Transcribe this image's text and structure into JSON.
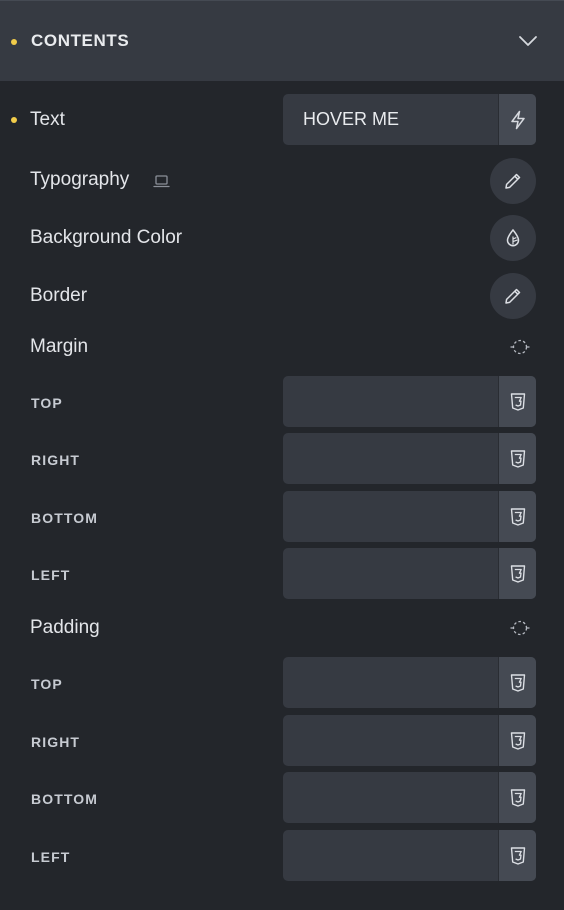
{
  "section": {
    "title": "CONTENTS"
  },
  "text_control": {
    "label": "Text",
    "value": "HOVER ME"
  },
  "typography": {
    "label": "Typography"
  },
  "background_color": {
    "label": "Background Color"
  },
  "border": {
    "label": "Border"
  },
  "margin": {
    "label": "Margin",
    "fields": [
      {
        "label": "TOP",
        "value": ""
      },
      {
        "label": "RIGHT",
        "value": ""
      },
      {
        "label": "BOTTOM",
        "value": ""
      },
      {
        "label": "LEFT",
        "value": ""
      }
    ]
  },
  "padding": {
    "label": "Padding",
    "fields": [
      {
        "label": "TOP",
        "value": ""
      },
      {
        "label": "RIGHT",
        "value": ""
      },
      {
        "label": "BOTTOM",
        "value": ""
      },
      {
        "label": "LEFT",
        "value": ""
      }
    ]
  },
  "colors": {
    "background": "#23262b",
    "header": "#363a42",
    "field": "#363a42",
    "addon": "#454a53",
    "indicator": "#f1cc4a",
    "text": "#e3e5e9"
  },
  "icons": {
    "collapse": "chevron-down-icon",
    "dynamic_data": "lightning-icon",
    "responsive": "monitor-icon",
    "edit": "pencil-icon",
    "color": "color-drop-icon",
    "link_sides": "link-dashed-icon",
    "css_unit": "css3-icon"
  }
}
